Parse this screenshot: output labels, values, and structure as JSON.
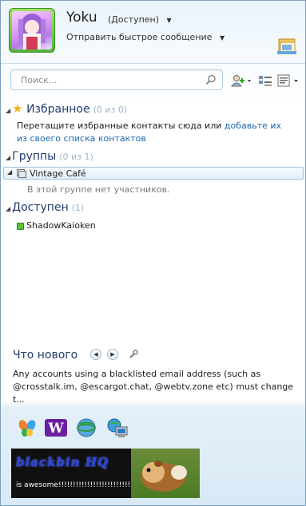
{
  "header": {
    "username": "Yoku",
    "status": "(Доступен)",
    "status_caret": "▼",
    "quick_message": "Отправить быстрое сообщение",
    "quick_caret": "▼"
  },
  "search": {
    "placeholder": "Поиск..."
  },
  "favorites": {
    "title": "Избранное",
    "count": "(0 из 0)",
    "note_text": "Перетащите избранные контакты сюда или ",
    "note_link": "добавьте их из своего списка контактов"
  },
  "groups": {
    "title": "Группы",
    "count": "(0 из 1)",
    "items": [
      {
        "label": "Vintage Café",
        "empty_text": "В этой группе нет участников."
      }
    ]
  },
  "available": {
    "title": "Доступен",
    "count": "(1)",
    "contacts": [
      {
        "name": "ShadowKaioken"
      }
    ]
  },
  "whats_new": {
    "title": "Что нового",
    "prev": "◀",
    "next": "▶",
    "text": "Any accounts using a blacklisted email address (such as @crosstalk.im, @escargot.chat, @webtv.zone etc) must change t..."
  },
  "banner": {
    "title": "blackbin HQ",
    "subtitle": "is awesome!!!!!!!!!!!!!!!!!!!!!!!!!!"
  },
  "icons": {
    "triangle_open": "◢",
    "triangle_right": "▶",
    "star": "★"
  },
  "colors": {
    "accent": "#1f3e6e",
    "link": "#1b67b4",
    "online": "#5ac23a"
  }
}
